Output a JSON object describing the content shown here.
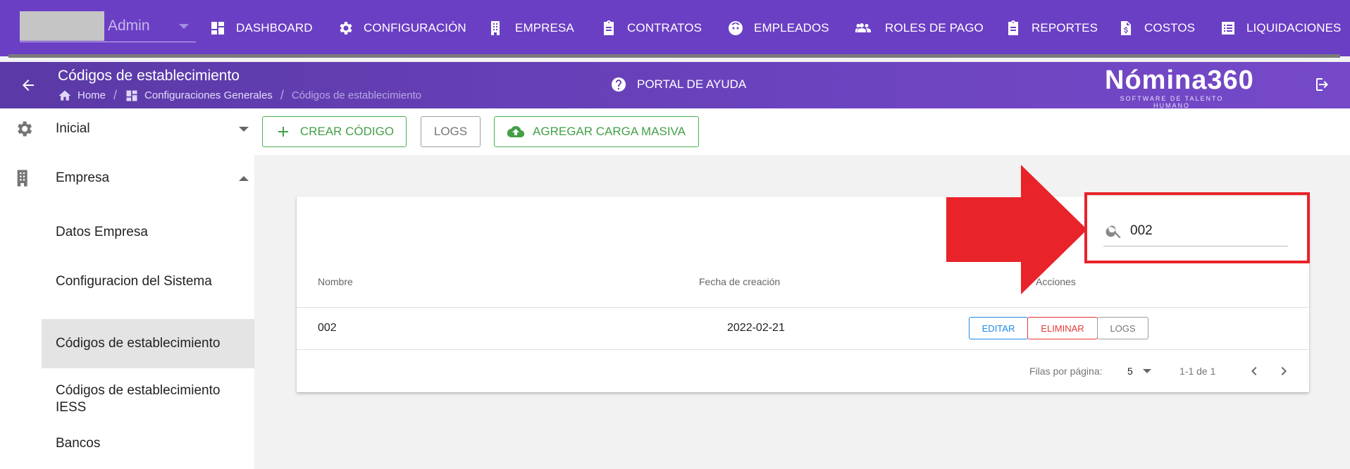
{
  "user": {
    "name": "Admin"
  },
  "topnav": [
    {
      "label": "DASHBOARD",
      "icon": "dashboard-icon"
    },
    {
      "label": "CONFIGURACIÓN",
      "icon": "gear-icon"
    },
    {
      "label": "EMPRESA",
      "icon": "building-icon"
    },
    {
      "label": "CONTRATOS",
      "icon": "clipboard-icon"
    },
    {
      "label": "EMPLEADOS",
      "icon": "face-icon"
    },
    {
      "label": "ROLES DE PAGO",
      "icon": "people-icon"
    },
    {
      "label": "REPORTES",
      "icon": "clipboard-icon"
    },
    {
      "label": "COSTOS",
      "icon": "document-dollar-icon"
    },
    {
      "label": "LIQUIDACIONES",
      "icon": "list-icon"
    }
  ],
  "header": {
    "title": "Códigos de establecimiento",
    "breadcrumb": [
      "Home",
      "Configuraciones Generales",
      "Códigos de establecimiento"
    ],
    "help": "PORTAL DE AYUDA",
    "brand": "Nómina360",
    "brand_sub": "SOFTWARE DE TALENTO HUMANO"
  },
  "sidebar": {
    "items": [
      {
        "label": "Inicial",
        "icon": "gear-icon",
        "expanded": false
      },
      {
        "label": "Empresa",
        "icon": "building-icon",
        "expanded": true
      }
    ],
    "subitems": [
      "Datos Empresa",
      "Configuracion del Sistema",
      "Códigos de establecimiento",
      "Códigos de establecimiento IESS",
      "Bancos"
    ],
    "active": "Códigos de establecimiento"
  },
  "toolbar": {
    "create": "CREAR CÓDIGO",
    "logs": "LOGS",
    "bulk": "AGREGAR CARGA MASIVA"
  },
  "table": {
    "search_value": "002",
    "columns": [
      "Nombre",
      "Fecha de creación",
      "Acciones"
    ],
    "rows": [
      {
        "nombre": "002",
        "fecha": "2022-02-21"
      }
    ],
    "actions": [
      "EDITAR",
      "ELIMINAR",
      "LOGS"
    ],
    "rows_per_page_label": "Filas por página:",
    "rows_per_page": "5",
    "range": "1-1 de 1"
  },
  "colors": {
    "nav": "#6b3fc4",
    "accent_green": "#43a047",
    "highlight_red": "#e8232a"
  }
}
